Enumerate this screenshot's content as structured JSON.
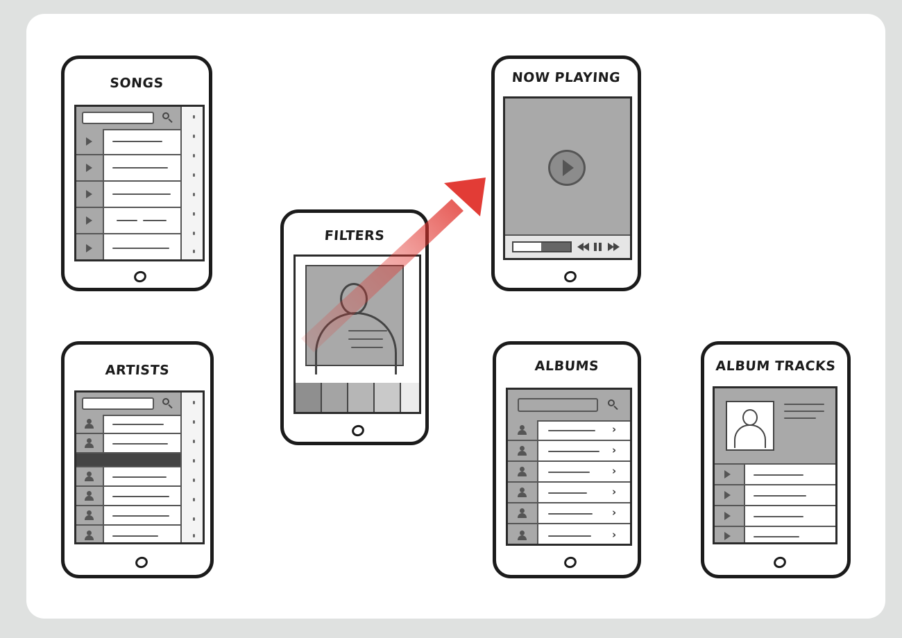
{
  "screens": {
    "songs": {
      "title": "SONGS"
    },
    "artists": {
      "title": "ARTISTS"
    },
    "filters": {
      "title": "FILTERS"
    },
    "now_playing": {
      "title": "NOW PLAYING"
    },
    "albums": {
      "title": "ALBUMS"
    },
    "album_tracks": {
      "title": "ALBUM TRACKS"
    }
  },
  "colors": {
    "background": "#dfe1e0",
    "canvas": "#ffffff",
    "sketch_gray": "#a9a9a9",
    "ink": "#1b1b1b",
    "arrow_red": "#e0312b"
  },
  "icons": [
    "search-icon",
    "play-icon",
    "person-icon",
    "chevron-right-icon",
    "rewind-icon",
    "pause-icon",
    "fast-forward-icon",
    "home-button-icon"
  ]
}
